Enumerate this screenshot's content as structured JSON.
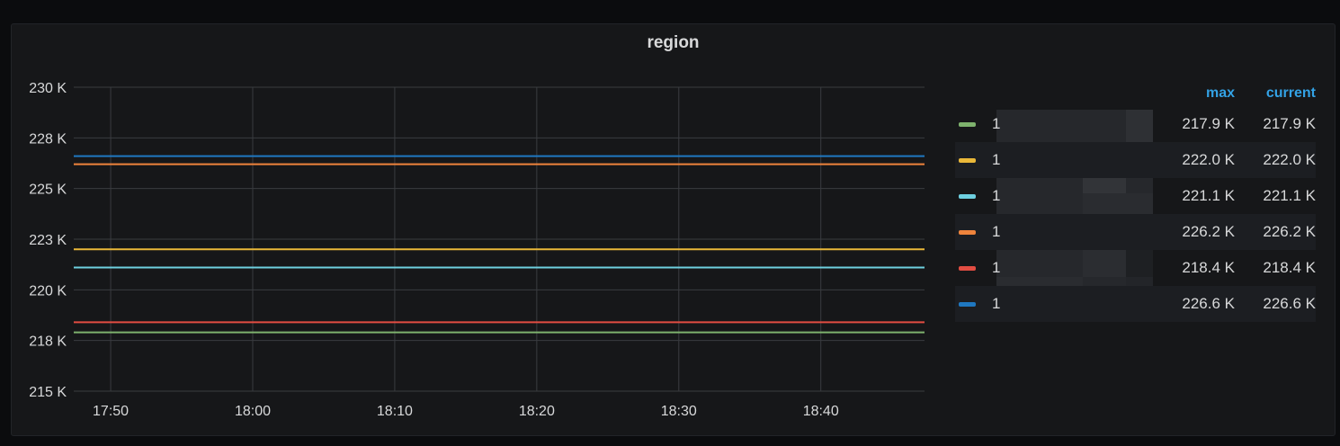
{
  "chart_data": {
    "type": "line",
    "title": "region",
    "xlabel": "",
    "ylabel": "",
    "x_unit": "time (HH:MM)",
    "xlim": [
      "17:47",
      "18:47"
    ],
    "ylim": [
      215000,
      230000
    ],
    "y_ticks": [
      215000,
      217500,
      220000,
      222500,
      225000,
      227500,
      230000
    ],
    "y_tick_labels": [
      "215 K",
      "218 K",
      "220 K",
      "223 K",
      "225 K",
      "228 K",
      "230 K"
    ],
    "x_ticks": [
      "17:50",
      "18:00",
      "18:10",
      "18:20",
      "18:30",
      "18:40"
    ],
    "grid": true,
    "legend_placement": "right",
    "legend_columns": [
      "max",
      "current"
    ],
    "series": [
      {
        "name": "1",
        "color": "#7eb26d",
        "value": 217900,
        "max": "217.9 K",
        "current": "217.9 K"
      },
      {
        "name": "1",
        "color": "#eab839",
        "value": 222000,
        "max": "222.0 K",
        "current": "222.0 K"
      },
      {
        "name": "1",
        "color": "#6ed0e0",
        "value": 221100,
        "max": "221.1 K",
        "current": "221.1 K"
      },
      {
        "name": "1",
        "color": "#ef843c",
        "value": 226200,
        "max": "226.2 K",
        "current": "226.2 K"
      },
      {
        "name": "1",
        "color": "#e24d42",
        "value": 218400,
        "max": "218.4 K",
        "current": "218.4 K"
      },
      {
        "name": "1",
        "color": "#1f78c1",
        "value": 226600,
        "max": "226.6 K",
        "current": "226.6 K"
      }
    ]
  }
}
